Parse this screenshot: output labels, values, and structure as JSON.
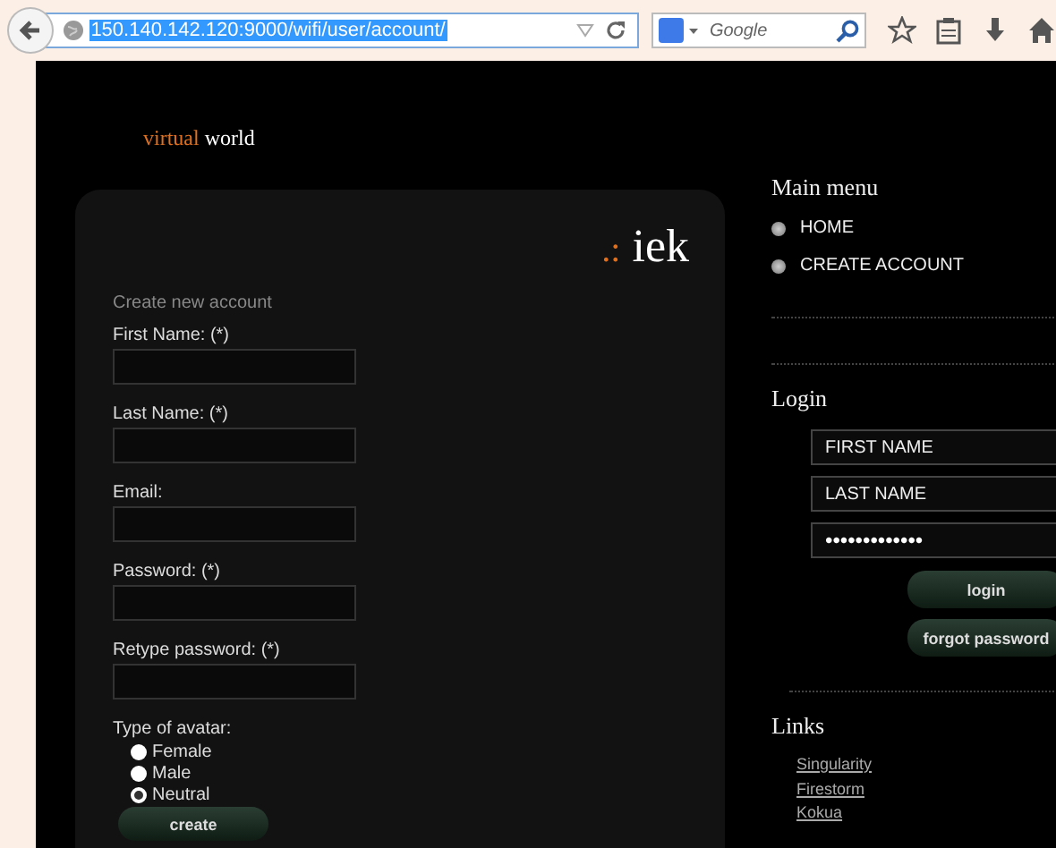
{
  "browser": {
    "url": "150.140.142.120:9000/wifi/user/account/",
    "url_selected": true,
    "search_placeholder": "Google"
  },
  "site": {
    "logo_first": "virtual",
    "logo_second": "world"
  },
  "card": {
    "brand_dots": ".:",
    "brand_name": "iek",
    "heading": "Create new account",
    "fields": [
      {
        "label": "First Name: (*)"
      },
      {
        "label": "Last Name: (*)"
      },
      {
        "label": "Email:"
      },
      {
        "label": "Password: (*)"
      },
      {
        "label": "Retype password: (*)"
      }
    ],
    "avatar_label": "Type of avatar:",
    "avatar_options": [
      {
        "label": "Female",
        "selected": false
      },
      {
        "label": "Male",
        "selected": false
      },
      {
        "label": "Neutral",
        "selected": true
      }
    ],
    "submit": "create"
  },
  "main_menu": {
    "title": "Main menu",
    "items": [
      {
        "label": "HOME"
      },
      {
        "label": "CREATE ACCOUNT"
      }
    ]
  },
  "login": {
    "title": "Login",
    "first_name_placeholder": "FIRST NAME",
    "last_name_placeholder": "LAST NAME",
    "password_value": "•••••••••••••",
    "buttons": [
      "login",
      "forgot password"
    ]
  },
  "links": {
    "title": "Links",
    "items": [
      "Singularity",
      "Firestorm",
      "Kokua"
    ]
  }
}
